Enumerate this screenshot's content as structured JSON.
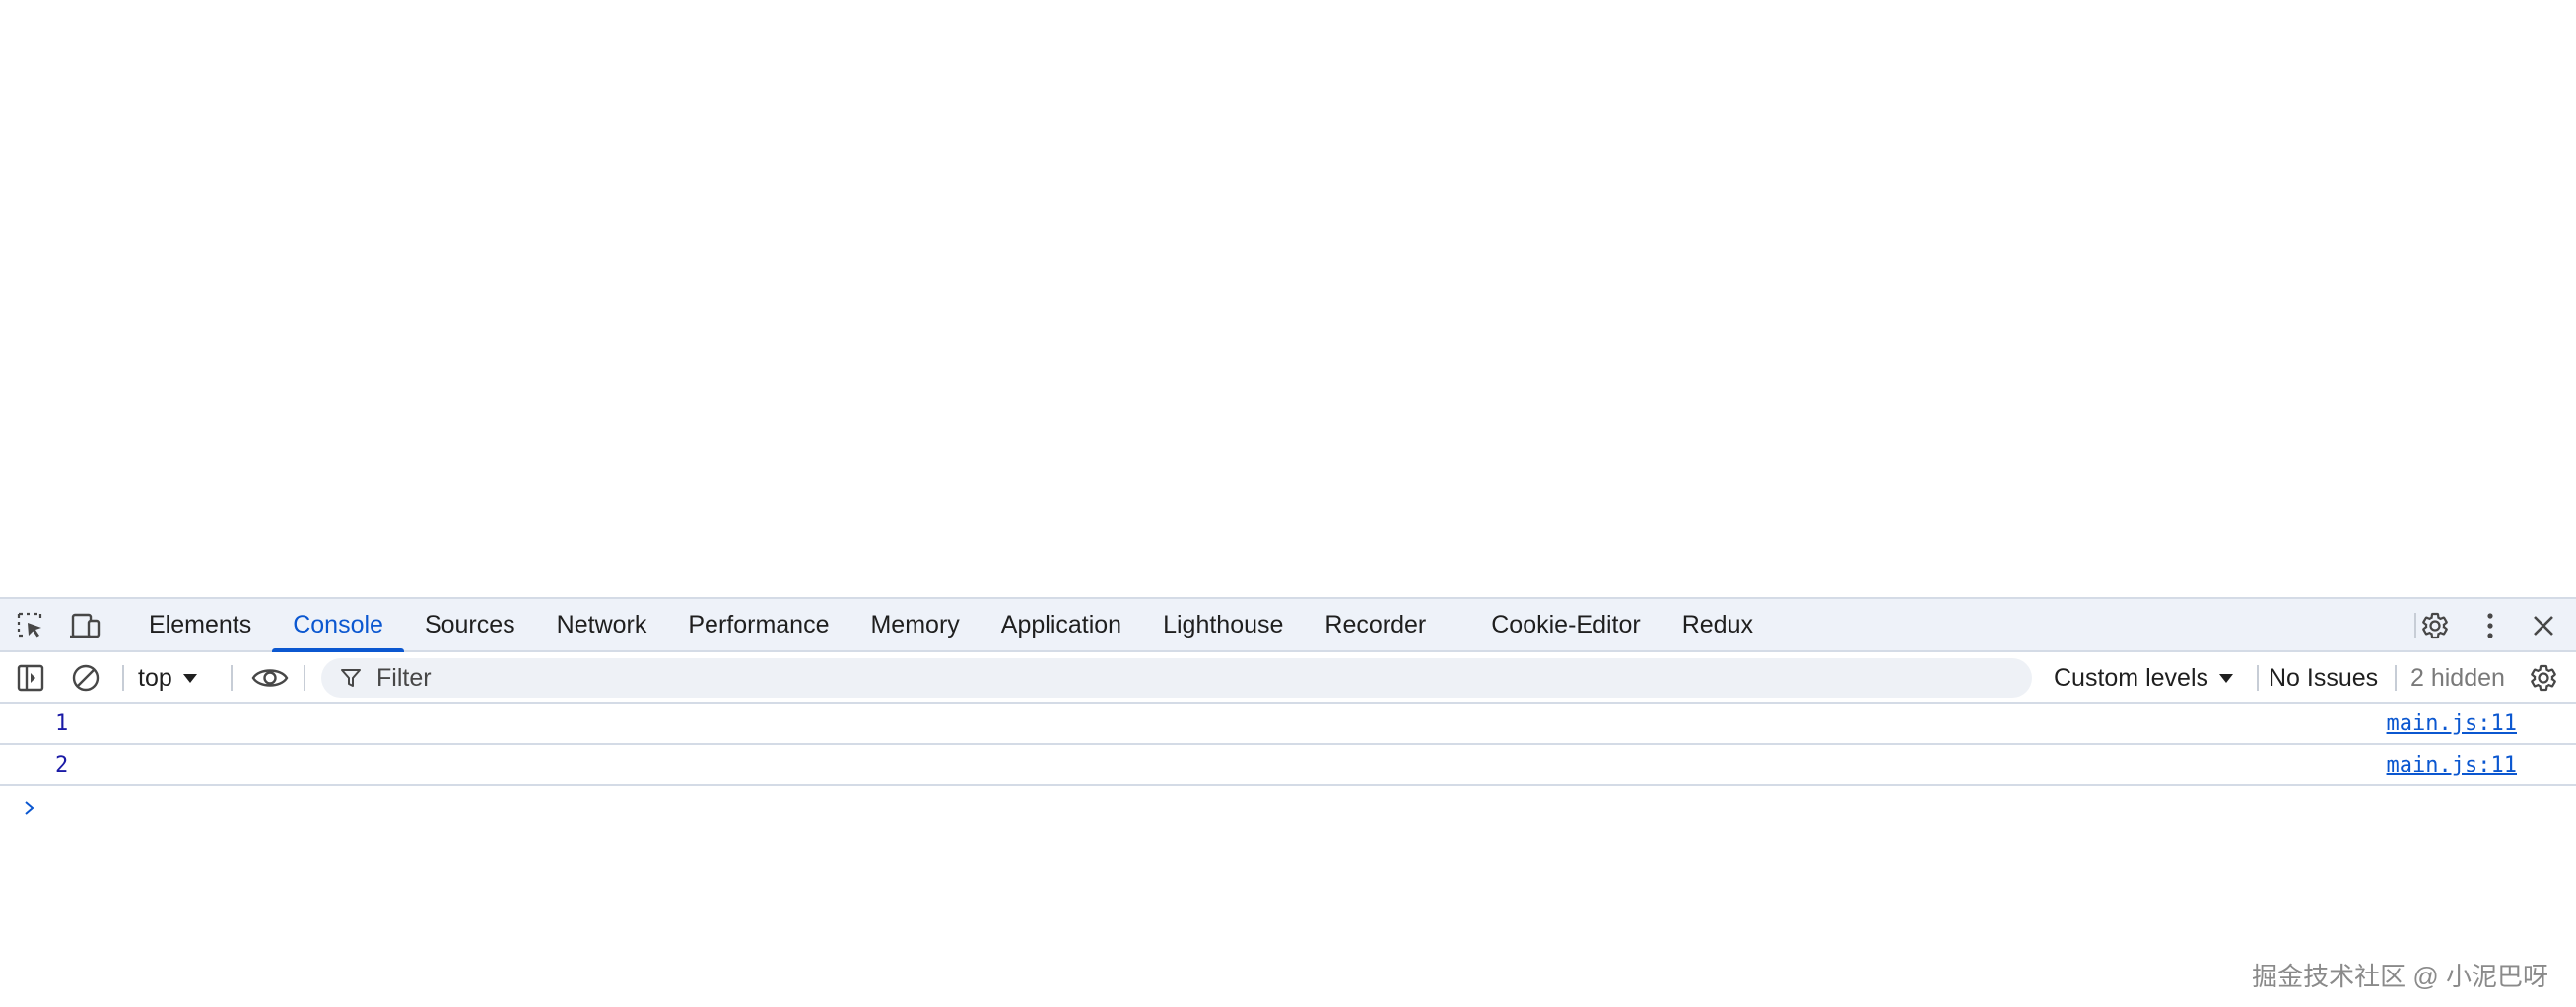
{
  "devtools": {
    "tabs": [
      {
        "label": "Elements",
        "active": false
      },
      {
        "label": "Console",
        "active": true
      },
      {
        "label": "Sources",
        "active": false
      },
      {
        "label": "Network",
        "active": false
      },
      {
        "label": "Performance",
        "active": false
      },
      {
        "label": "Memory",
        "active": false
      },
      {
        "label": "Application",
        "active": false
      },
      {
        "label": "Lighthouse",
        "active": false
      },
      {
        "label": "Recorder",
        "active": false
      },
      {
        "label": "Cookie-Editor",
        "active": false
      },
      {
        "label": "Redux",
        "active": false
      }
    ],
    "icons": {
      "inspect": "inspect-element-icon",
      "device": "device-toolbar-icon",
      "settings": "gear-icon",
      "more": "kebab-menu-icon",
      "close": "close-icon"
    },
    "accent_color": "#0b57d0"
  },
  "console": {
    "toolbar": {
      "context": "top",
      "filter_placeholder": "Filter",
      "filter_value": "",
      "levels_label": "Custom levels",
      "issues_label": "No Issues",
      "hidden_label": "2 hidden"
    },
    "messages": [
      {
        "value": "1",
        "source": "main.js:11"
      },
      {
        "value": "2",
        "source": "main.js:11"
      }
    ],
    "value_color": "#1a1aa6"
  },
  "watermark": "掘金技术社区 @ 小泥巴呀"
}
